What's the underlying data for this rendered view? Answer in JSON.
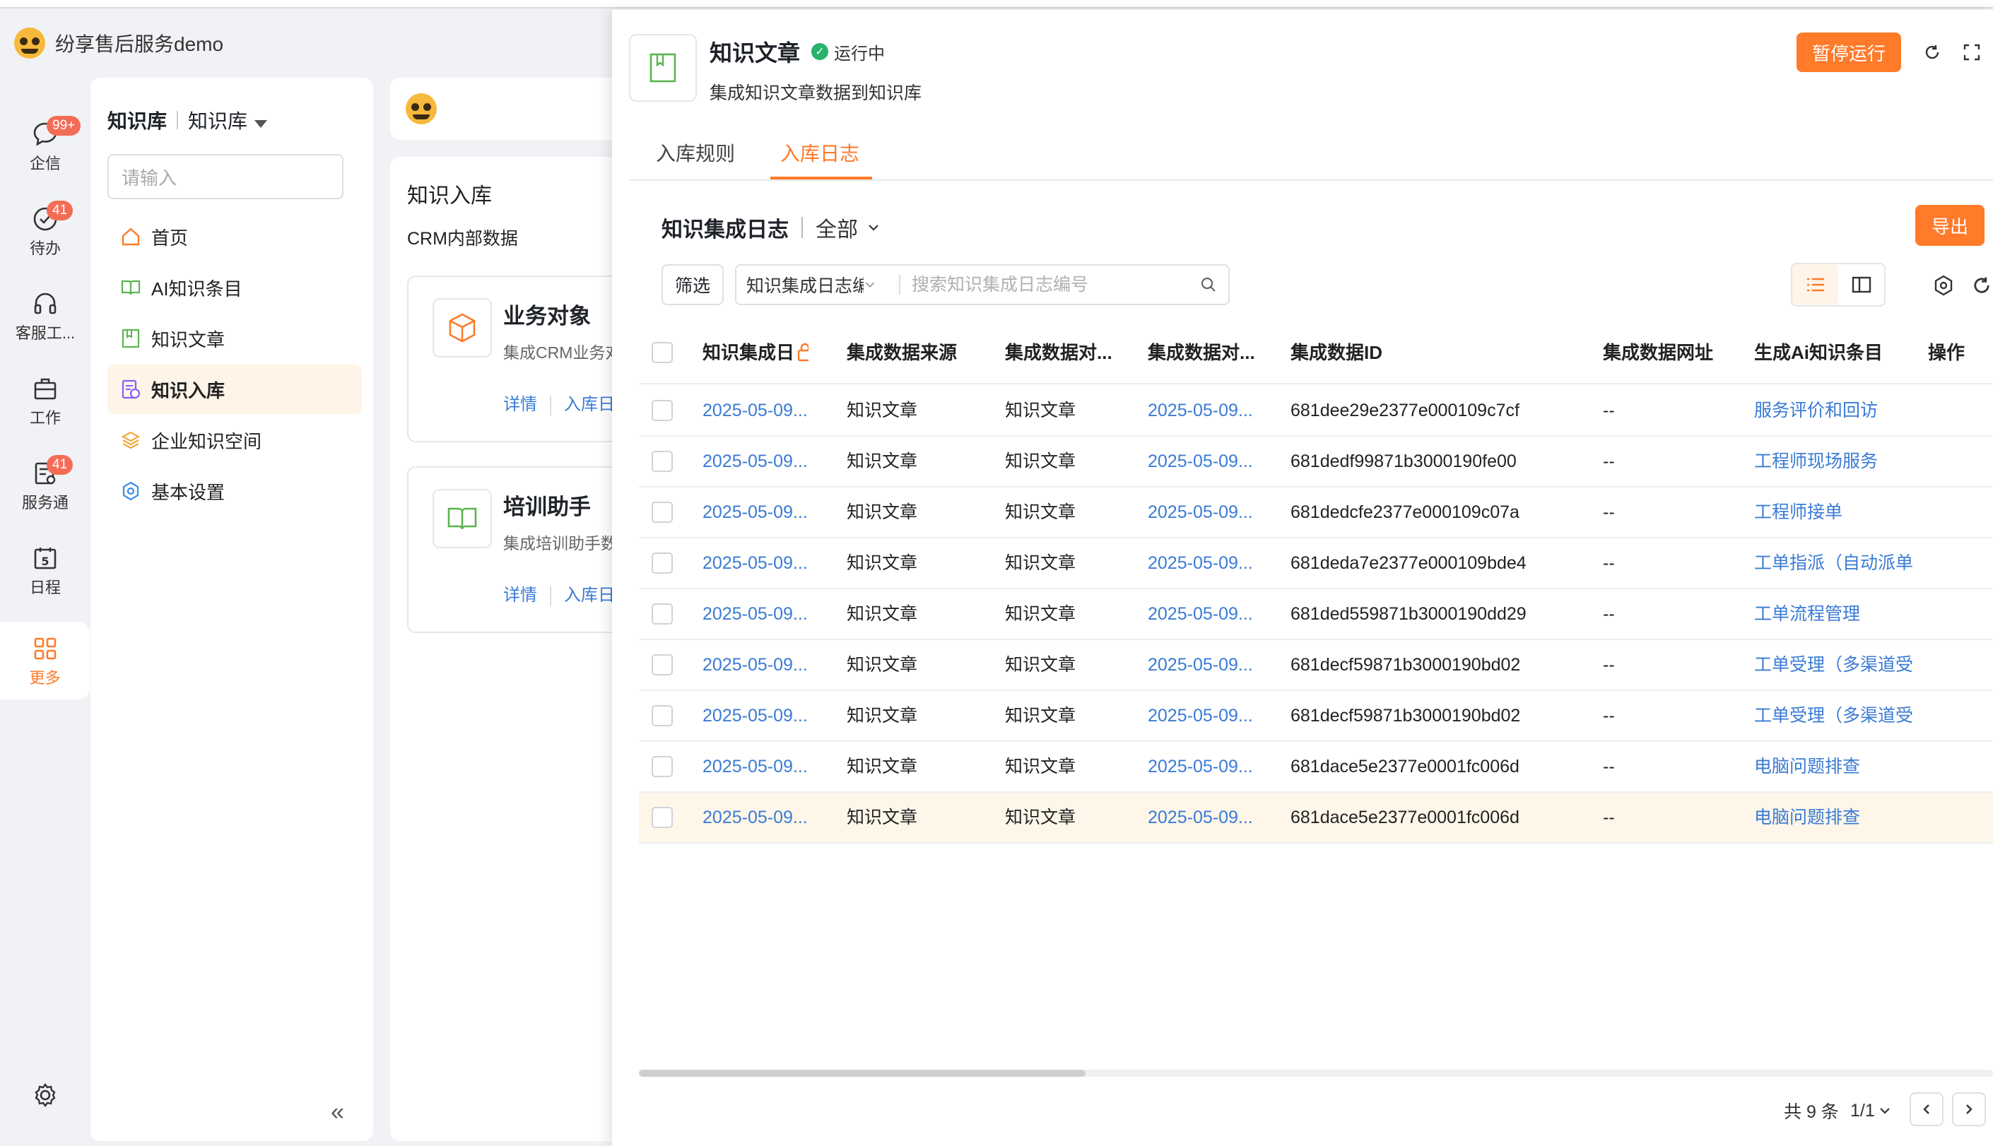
{
  "app": {
    "title": "纷享售后服务demo"
  },
  "rail": {
    "items": [
      {
        "label": "企信",
        "badge": "99+"
      },
      {
        "label": "待办",
        "badge": "41"
      },
      {
        "label": "客服工...",
        "badge": ""
      },
      {
        "label": "工作",
        "badge": ""
      },
      {
        "label": "服务通",
        "badge": "41"
      },
      {
        "label": "日程",
        "badge": "",
        "day": "5"
      },
      {
        "label": "更多",
        "badge": ""
      }
    ]
  },
  "kb": {
    "title": "知识库",
    "switch": "知识库",
    "search_placeholder": "请输入",
    "menu": [
      "首页",
      "AI知识条目",
      "知识文章",
      "知识入库",
      "企业知识空间",
      "基本设置"
    ]
  },
  "mid": {
    "heading": "知识入库",
    "section": "CRM内部数据",
    "cards": [
      {
        "title": "业务对象",
        "desc": "集成CRM业务对",
        "link1": "详情",
        "link2": "入库日"
      },
      {
        "title": "培训助手",
        "desc": "集成培训助手数",
        "link1": "详情",
        "link2": "入库日"
      }
    ]
  },
  "drawer": {
    "title": "知识文章",
    "status": "运行中",
    "subtitle": "集成知识文章数据到知识库",
    "pause_label": "暂停运行",
    "tabs": [
      "入库规则",
      "入库日志"
    ],
    "list_title": "知识集成日志",
    "scope_filter": "全部",
    "export_label": "导出",
    "filter_label": "筛选",
    "search_field": "知识集成日志编号",
    "search_placeholder": "搜索知识集成日志编号",
    "columns": [
      "知识集成日",
      "集成数据来源",
      "集成数据对...",
      "集成数据对...",
      "集成数据ID",
      "集成数据网址",
      "生成Ai知识条目",
      "操作"
    ],
    "rows": [
      [
        "2025-05-09...",
        "知识文章",
        "知识文章",
        "2025-05-09...",
        "681dee29e2377e000109c7cf",
        "--",
        "服务评价和回访"
      ],
      [
        "2025-05-09...",
        "知识文章",
        "知识文章",
        "2025-05-09...",
        "681dedf99871b3000190fe00",
        "--",
        "工程师现场服务"
      ],
      [
        "2025-05-09...",
        "知识文章",
        "知识文章",
        "2025-05-09...",
        "681dedcfe2377e000109c07a",
        "--",
        "工程师接单"
      ],
      [
        "2025-05-09...",
        "知识文章",
        "知识文章",
        "2025-05-09...",
        "681deda7e2377e000109bde4",
        "--",
        "工单指派（自动派单"
      ],
      [
        "2025-05-09...",
        "知识文章",
        "知识文章",
        "2025-05-09...",
        "681ded559871b3000190dd29",
        "--",
        "工单流程管理"
      ],
      [
        "2025-05-09...",
        "知识文章",
        "知识文章",
        "2025-05-09...",
        "681decf59871b3000190bd02",
        "--",
        "工单受理（多渠道受"
      ],
      [
        "2025-05-09...",
        "知识文章",
        "知识文章",
        "2025-05-09...",
        "681decf59871b3000190bd02",
        "--",
        "工单受理（多渠道受"
      ],
      [
        "2025-05-09...",
        "知识文章",
        "知识文章",
        "2025-05-09...",
        "681dace5e2377e0001fc006d",
        "--",
        "电脑问题排查"
      ],
      [
        "2025-05-09...",
        "知识文章",
        "知识文章",
        "2025-05-09...",
        "681dace5e2377e0001fc006d",
        "--",
        "电脑问题排查"
      ]
    ],
    "total": "共 9 条",
    "page": "1/1"
  },
  "colors": {
    "accent": "#ff7a29",
    "link": "#3a7bd5",
    "success": "#27b36a",
    "badge": "#f56c56"
  }
}
